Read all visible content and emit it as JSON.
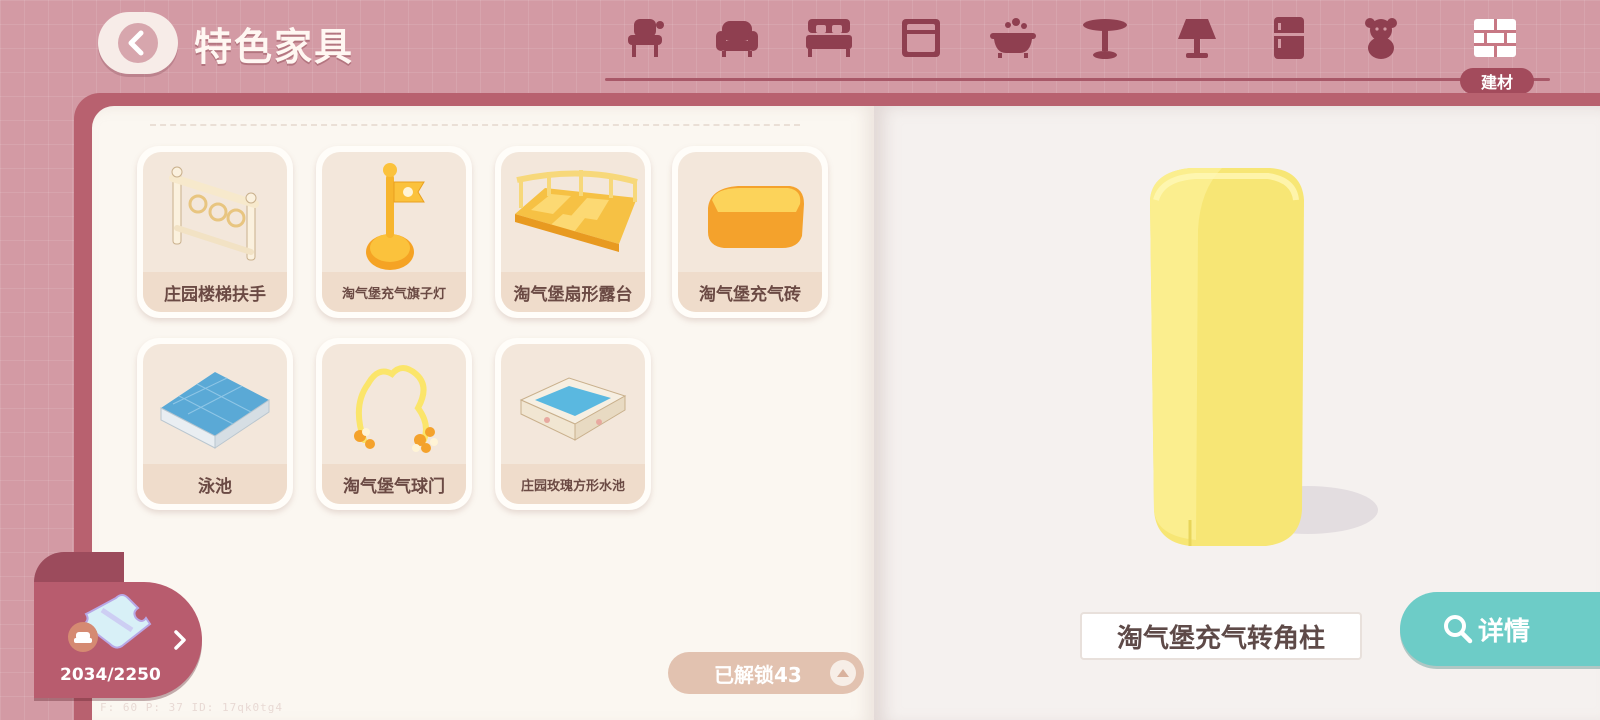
{
  "header": {
    "title": "特色家具",
    "categories": [
      {
        "icon": "maid-chair-icon"
      },
      {
        "icon": "armchair-icon"
      },
      {
        "icon": "bed-icon"
      },
      {
        "icon": "cabinet-icon"
      },
      {
        "icon": "bathtub-icon"
      },
      {
        "icon": "table-icon"
      },
      {
        "icon": "lamp-icon"
      },
      {
        "icon": "fridge-icon"
      },
      {
        "icon": "teddy-bear-icon"
      },
      {
        "icon": "building-material-icon",
        "label": "建材",
        "active": true
      }
    ]
  },
  "items": [
    {
      "label": "庄园楼梯扶手"
    },
    {
      "label": "淘气堡充气旗子灯"
    },
    {
      "label": "淘气堡扇形露台"
    },
    {
      "label": "淘气堡充气砖"
    },
    {
      "label": "泳池"
    },
    {
      "label": "淘气堡气球门"
    },
    {
      "label": "庄园玫瑰方形水池"
    }
  ],
  "puzzle": {
    "count": "2034/2250"
  },
  "unlock": {
    "label": "已解锁43"
  },
  "preview": {
    "name": "淘气堡充气转角柱"
  },
  "detail_button": {
    "label": "详情"
  },
  "debug": {
    "text": "F: 60   P: 37   ID: 17qk0tg4"
  },
  "colors": {
    "background": "#d39aa4",
    "accent": "#6dccc7",
    "active_label": "#a34b5c"
  }
}
